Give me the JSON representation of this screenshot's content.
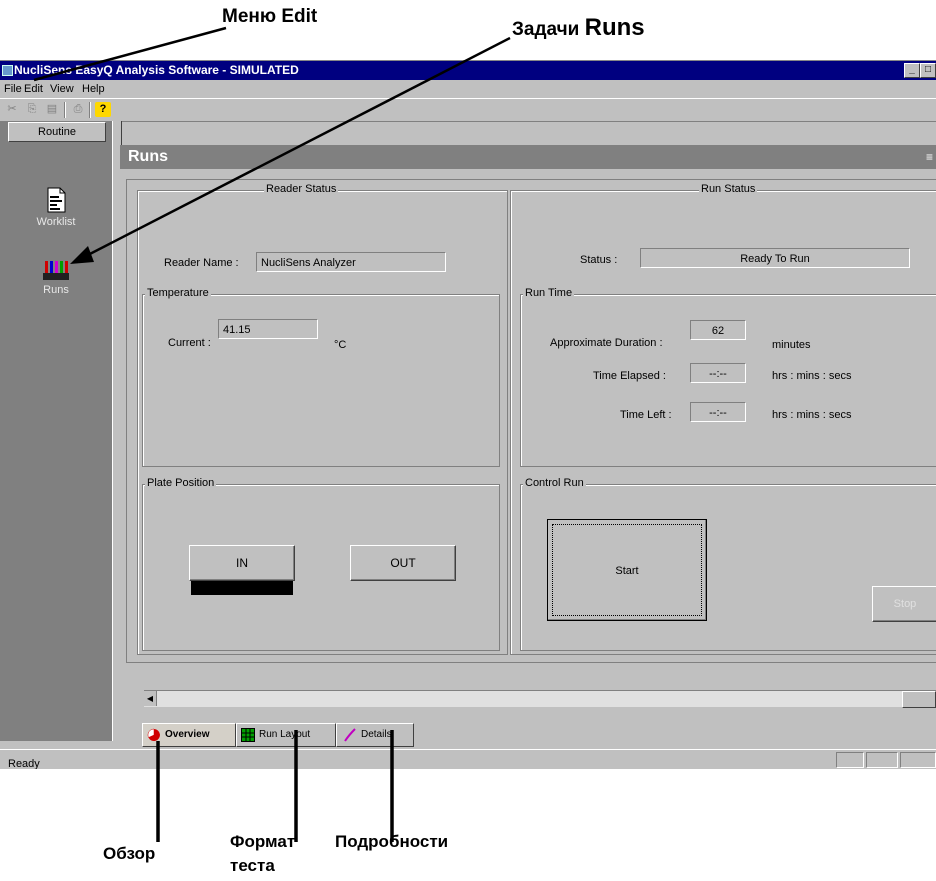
{
  "callouts": {
    "edit_menu": "Меню Edit",
    "runs_tasks_prefix": "Задачи ",
    "runs_tasks_bold": "Runs",
    "overview": "Обзор",
    "test_format_line1": "Формат",
    "test_format_line2": "теста",
    "details": "Подробности"
  },
  "window": {
    "title": "NucliSens EasyQ Analysis Software - SIMULATED",
    "minimize_glyph": "_",
    "maximize_glyph": "□"
  },
  "menu": {
    "file": "File",
    "edit": "Edit",
    "view": "View",
    "help": "Help"
  },
  "toolbar": {
    "icons": [
      "cut-icon",
      "copy-icon",
      "paste-icon",
      "print-icon",
      "help-icon"
    ],
    "cut": "✂",
    "copy": "⎘",
    "paste": "▤",
    "print": "⎙",
    "help": "?"
  },
  "sidebar": {
    "group": "Routine",
    "items": [
      {
        "label": "Worklist",
        "icon": "worklist-icon"
      },
      {
        "label": "Runs",
        "icon": "runs-icon"
      }
    ]
  },
  "page": {
    "title": "Runs"
  },
  "reader_status": {
    "legend": "Reader Status",
    "reader_name_label": "Reader Name :",
    "reader_name_value": "NucliSens Analyzer"
  },
  "temperature": {
    "legend": "Temperature",
    "current_label": "Current :",
    "current_value": "41.15",
    "unit": "°C"
  },
  "plate_position": {
    "legend": "Plate Position",
    "in_label": "IN",
    "out_label": "OUT"
  },
  "run_status": {
    "legend": "Run Status",
    "status_label": "Status :",
    "status_value": "Ready To Run"
  },
  "run_time": {
    "legend": "Run Time",
    "approx_label": "Approximate Duration :",
    "approx_value": "62",
    "approx_unit": "minutes",
    "elapsed_label": "Time Elapsed :",
    "elapsed_value": "--:--",
    "elapsed_unit": "hrs : mins : secs",
    "left_label": "Time Left :",
    "left_value": "--:--",
    "left_unit": "hrs : mins : secs"
  },
  "control_run": {
    "legend": "Control Run",
    "start_label": "Start",
    "stop_label": "Stop"
  },
  "tabs": [
    {
      "label": "Overview",
      "icon": "overview-icon"
    },
    {
      "label": "Run Layout",
      "icon": "run-layout-icon"
    },
    {
      "label": "Details",
      "icon": "details-icon"
    }
  ],
  "statusbar": {
    "text": "Ready"
  }
}
